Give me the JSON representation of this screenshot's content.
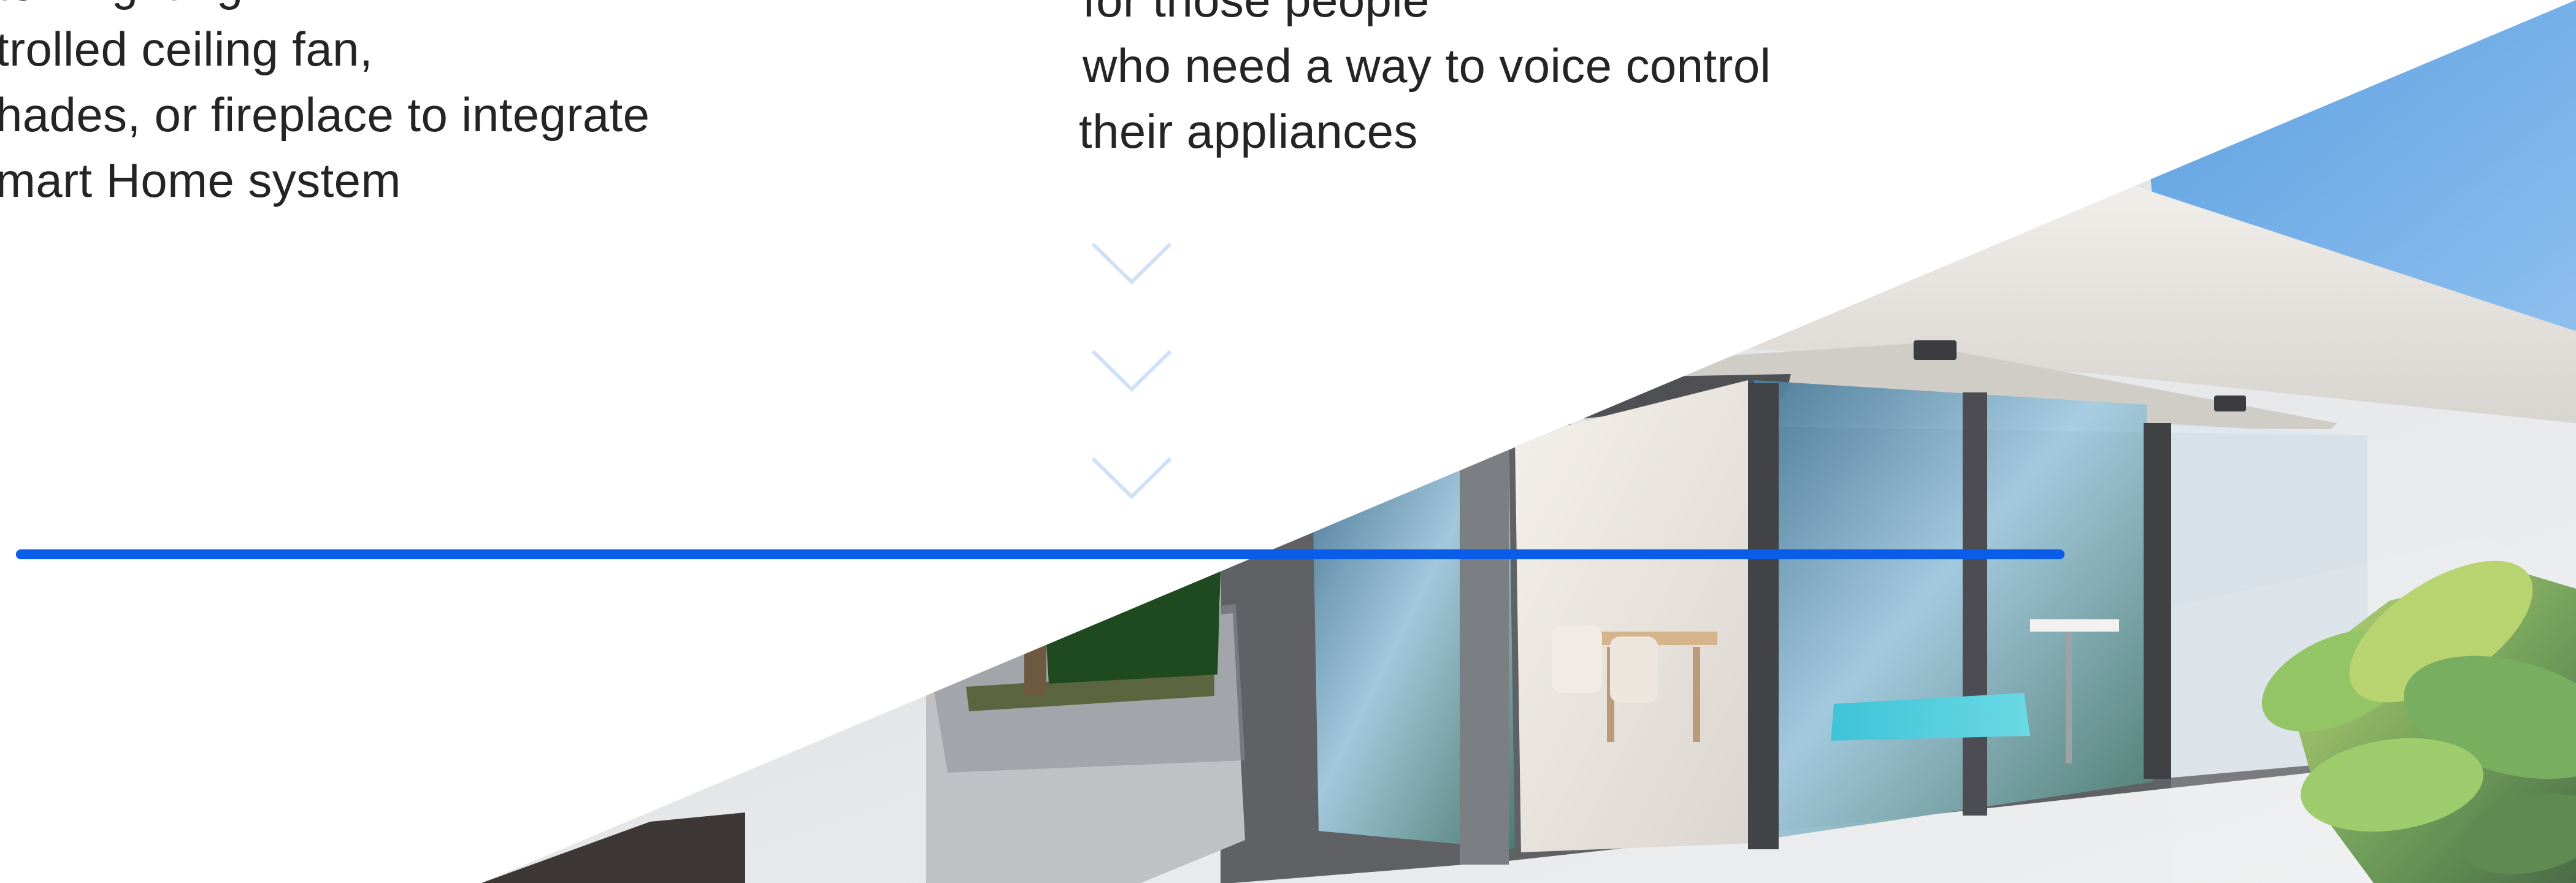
{
  "copy": {
    "left_lines": [
      "tem lighting",
      "trolled ceiling fan,",
      "hades, or fireplace to integrate",
      "mart Home system"
    ],
    "middle_lines": [
      "for those people",
      "who need a way to voice control",
      "their appliances"
    ]
  },
  "scroll_indicator": {
    "icon": "chevron-down-icon",
    "count": 3,
    "color": "#cfe1f6"
  },
  "divider": {
    "color": "#0a5de8"
  },
  "hero": {
    "subject": "modern house exterior with glass sliding doors, patio, pool and plant"
  }
}
